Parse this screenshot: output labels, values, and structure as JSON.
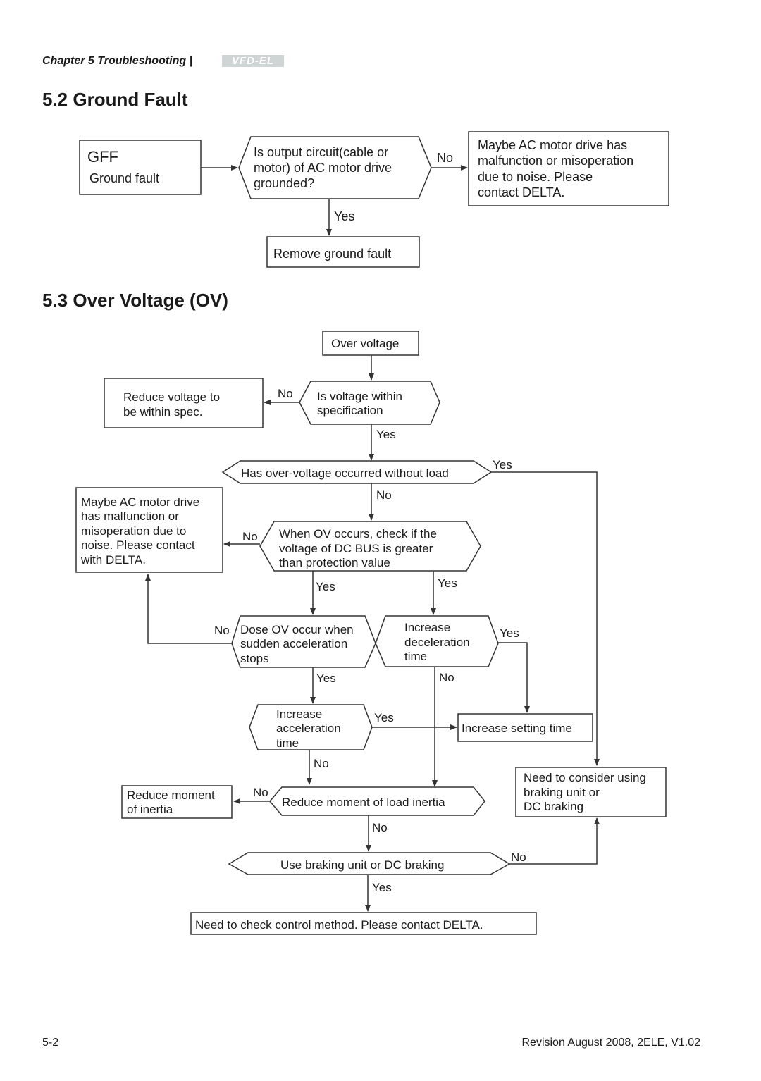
{
  "header": {
    "chapter": "Chapter 5  Troubleshooting |",
    "logo": "VFD-EL"
  },
  "sections": {
    "ground_fault": {
      "title": "5.2 Ground Fault",
      "start_code": "GFF",
      "start_label": "Ground fault",
      "question": [
        "Is output circuit(cable or",
        "motor) of AC motor drive",
        "grounded?"
      ],
      "no_label": "No",
      "yes_label": "Yes",
      "no_result": [
        "Maybe AC motor drive  has",
        "malfunction or misoperation",
        "due to noise. Please",
        "contact DELTA."
      ],
      "yes_result": "Remove ground fault"
    },
    "over_voltage": {
      "title": "5.3 Over Voltage (OV)",
      "start": "Over voltage",
      "q_within_spec": [
        "Is voltage within",
        "specification"
      ],
      "reduce_voltage": [
        "Reduce voltage to",
        "be within spec."
      ],
      "q_without_load": "Has over-voltage occurred without load",
      "maybe_drive": [
        "Maybe AC motor drive",
        "has malfunction or",
        "misoperation due to",
        "noise. Please contact",
        "with DELTA."
      ],
      "q_dc_bus": [
        "When OV occurs, check if the",
        "voltage of DC BUS is greater",
        "than protection value"
      ],
      "q_sudden_accel": [
        "Dose OV occur when",
        "sudden acceleration",
        "stops"
      ],
      "q_increase_decel": [
        "Increase",
        "deceleration",
        "time"
      ],
      "q_increase_accel": [
        "Increase",
        "acceleration",
        "time"
      ],
      "increase_setting": "Increase setting time",
      "consider_braking": [
        "Need to consider using",
        "braking unit  or",
        "DC braking"
      ],
      "reduce_moment": [
        "Reduce moment",
        "of inertia"
      ],
      "q_reduce_load_inertia": "Reduce moment of load  inertia",
      "q_use_braking": "Use braking unit or DC braking",
      "check_control": "Need to check control method. Please contact DELTA.",
      "yes": "Yes",
      "no": "No"
    }
  },
  "footer": {
    "page": "5-2",
    "revision": "Revision August 2008, 2ELE, V1.02"
  }
}
